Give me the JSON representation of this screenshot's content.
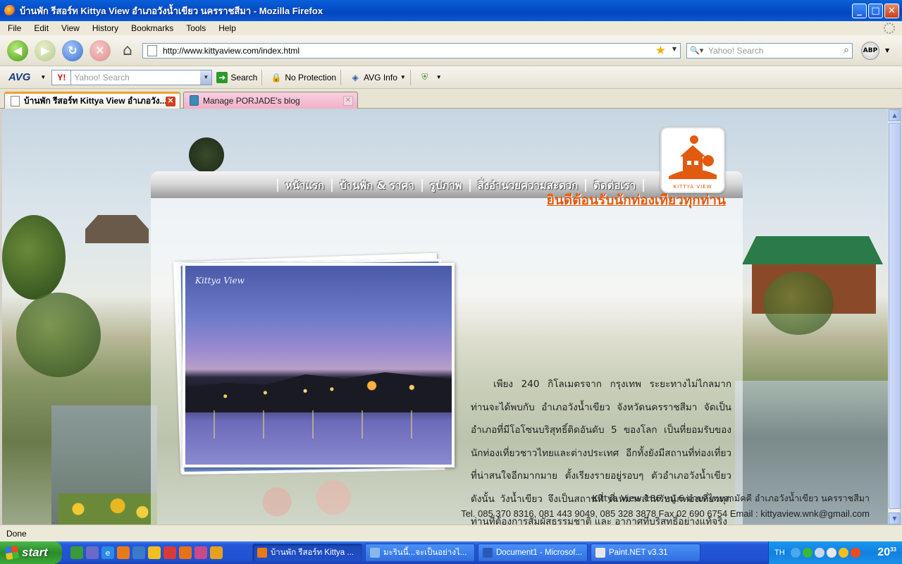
{
  "window": {
    "title": "บ้านพัก รีสอร์ท Kittya View อำเภอวังน้ำเขียว นครราชสีมา - Mozilla Firefox",
    "buttons": {
      "minimize": "_",
      "maximize": "□",
      "close": "✕"
    }
  },
  "menu": [
    "File",
    "Edit",
    "View",
    "History",
    "Bookmarks",
    "Tools",
    "Help"
  ],
  "navbar": {
    "url": "http://www.kittyaview.com/index.html",
    "search_placeholder": "Yahoo! Search",
    "abp_label": "ABP"
  },
  "avg_toolbar": {
    "logo": "AVG",
    "yahoo_label": "Y!",
    "search_placeholder": "Yahoo! Search",
    "search_button": "Search",
    "protection": "No Protection",
    "info": "AVG Info"
  },
  "tabs": [
    {
      "title": "บ้านพัก รีสอร์ท Kittya View อำเภอวัง...",
      "active": true
    },
    {
      "title": "Manage PORJADE's blog",
      "active": false
    }
  ],
  "site": {
    "nav": [
      "หน้าแรก",
      "บ้านพัก & ราคา",
      "รูปภาพ",
      "สิ่งอำนวยความสะดวก",
      "ติดต่อเรา"
    ],
    "logo_text": "KITTYA VIEW",
    "welcome": "ยินดีต้อนรับนักท่องเที่ยวทุกท่าน",
    "photo_caption_title": "Kittya View",
    "description": "เพียง 240 กิโลเมตรจาก กรุงเทพ ระยะทางไม่ไกลมาก ท่านจะได้พบกับ อำเภอวังน้ำเขียว จังหวัดนครราชสีมา จัดเป็นอำเภอที่มีโอโซนบริสุทธิ์ติดอันดับ 5 ของโลก เป็นที่ยอมรับของนักท่องเที่ยวชาวไทยและต่างประเทศ อีกทั้งยังมีสถานที่ท่องเที่ยวที่น่าสนใจอีกมากมาย ตั้งเรียงรายอยู่รอบๆ ตัวอำเภอวังน้ำเขียว ดังนั้น วังน้ำเขียว จึงเป็นสถานที่ ที่เหมาะสำหรับนักท่องเที่ยวทุกท่านที่ต้องการสัมผัสธรรมชาติ และ อากาศที่บริสุทธิ์อย่างแท้จริง",
    "address": "Kittya View  186  หมู่  6 ตำบลไทยสามัคคี อำเภอวังน้ำเขียว นครราชสีมา",
    "contact": "Tel.  085 370 8316, 081 443 9049, 085 328 3878  Fax 02 690 6754  Email : kittyaview.wnk@gmail.com"
  },
  "status": "Done",
  "taskbar": {
    "start": "start",
    "tasks": [
      {
        "label": "บ้านพัก รีสอร์ท Kittya ...",
        "active": true
      },
      {
        "label": "มะรินนี้...จะเป็นอย่างไ...",
        "active": false
      },
      {
        "label": "Document1 - Microsof...",
        "active": false
      },
      {
        "label": "Paint.NET v3.31",
        "active": false
      }
    ],
    "lang": "TH",
    "clock_hour": "20",
    "clock_min": "33"
  },
  "colors": {
    "accent": "#e05a10",
    "titlebar": "#0450c8",
    "taskbar": "#2458d8"
  }
}
